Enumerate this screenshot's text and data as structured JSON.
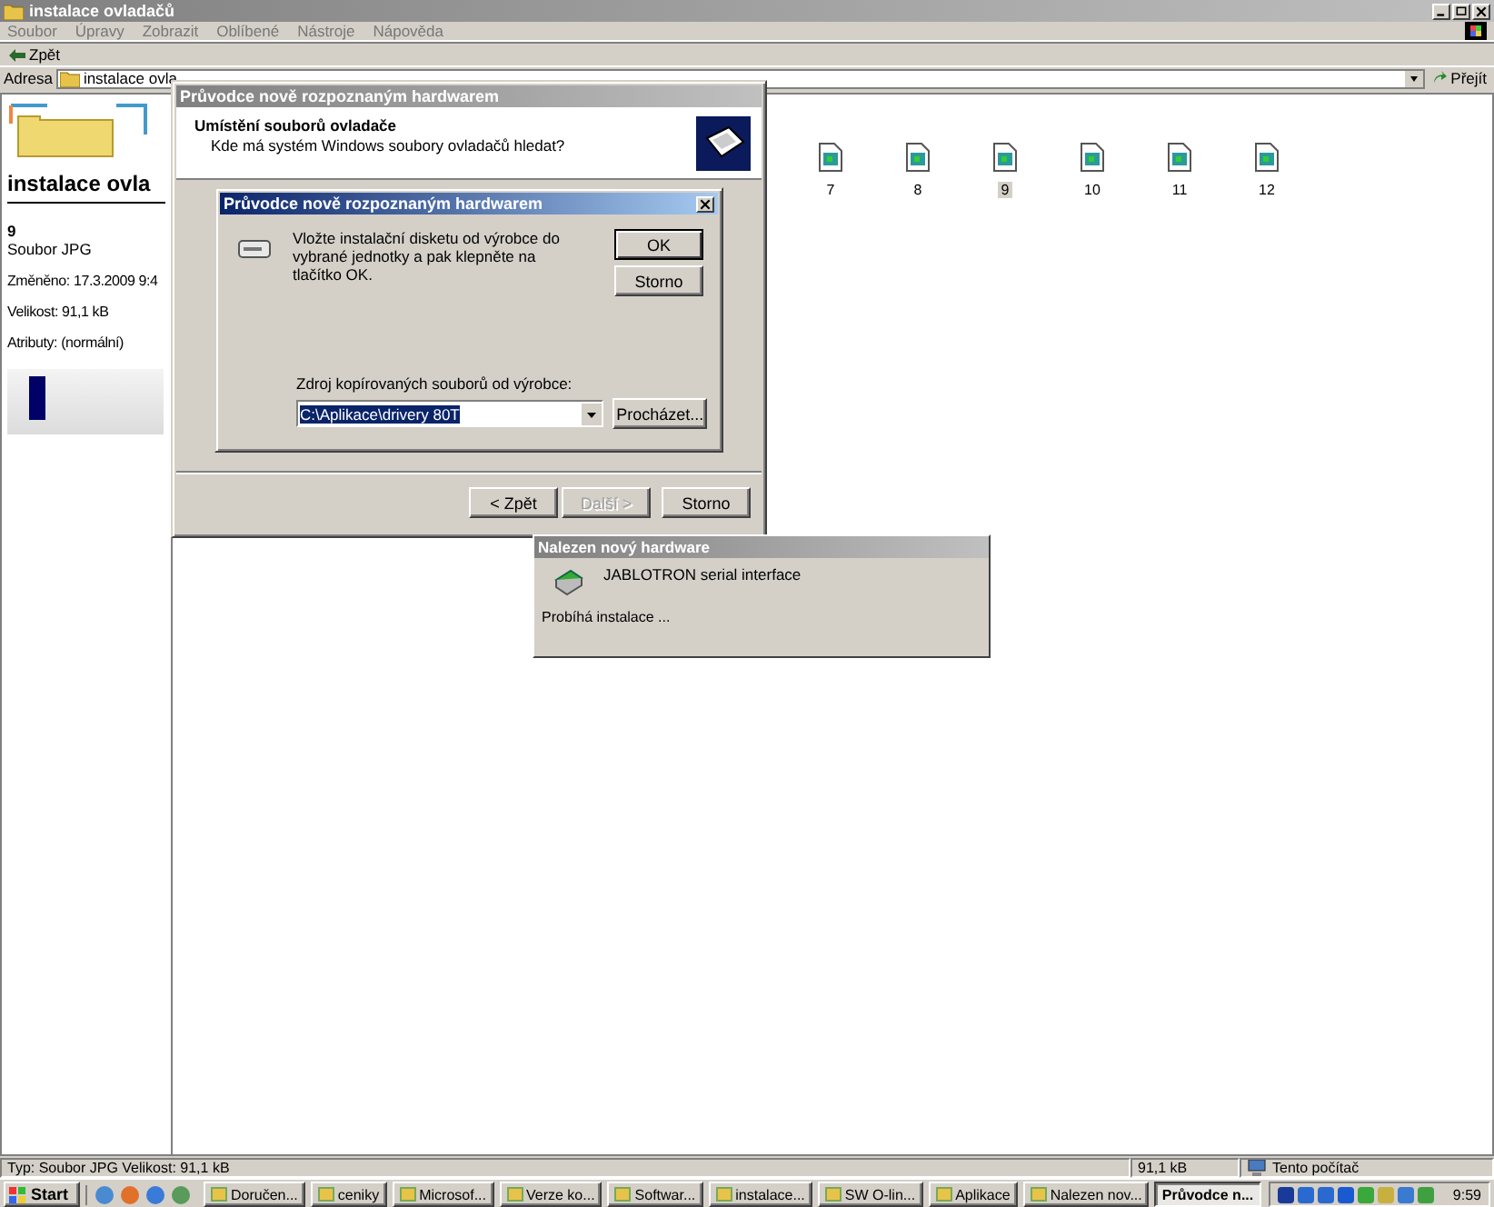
{
  "explorer": {
    "title": "instalace ovladačů",
    "menu": [
      "Soubor",
      "Úpravy",
      "Zobrazit",
      "Oblíbené",
      "Nástroje",
      "Nápověda"
    ],
    "toolbar": {
      "back": "Zpět"
    },
    "address": {
      "label": "Adresa",
      "value": "instalace ovla",
      "go": "Přejít"
    },
    "panel": {
      "heading": "instalace ovla",
      "name": "9",
      "type": "Soubor JPG",
      "details": [
        "Změněno: 17.3.2009 9:4",
        "Velikost: 91,1 kB",
        "Atributy: (normální)"
      ]
    },
    "files": [
      {
        "name": "7",
        "selected": false
      },
      {
        "name": "8",
        "selected": false
      },
      {
        "name": "9",
        "selected": true
      },
      {
        "name": "10",
        "selected": false
      },
      {
        "name": "11",
        "selected": false
      },
      {
        "name": "12",
        "selected": false
      }
    ],
    "status_bar": [
      "Typ: Soubor JPG Velikost: 91,1 kB",
      "91,1 kB",
      "Tento počítač"
    ]
  },
  "wizard": {
    "title": "Průvodce nově rozpoznaným hardwarem",
    "heading": "Umístění souborů ovladače",
    "subheading": "Kde má systém Windows soubory ovladačů hledat?",
    "buttons": [
      {
        "label": "< Zpět",
        "disabled": false
      },
      {
        "label": "Další >",
        "disabled": true
      },
      {
        "label": "Storno",
        "disabled": false
      }
    ]
  },
  "disk_dialog": {
    "title": "Průvodce nově rozpoznaným hardwarem",
    "message": "Vložte instalační disketu od výrobce do vybrané jednotky a pak klepněte na tlačítko OK.",
    "buttons": [
      "OK",
      "Storno"
    ],
    "source": {
      "label": "Zdroj kopírovaných souborů od výrobce:",
      "value": "C:\\Aplikace\\drivery 80T",
      "browse": "Procházet..."
    }
  },
  "notification": {
    "title": "Nalezen nový hardware",
    "device": "JABLOTRON serial interface",
    "status": "Probíhá instalace ..."
  },
  "taskbar": {
    "start": "Start",
    "tasks": [
      {
        "label": "Doručen...",
        "selected": false
      },
      {
        "label": "ceniky",
        "selected": false
      },
      {
        "label": "Microsof...",
        "selected": false
      },
      {
        "label": "Verze ko...",
        "selected": false
      },
      {
        "label": "Softwar...",
        "selected": false
      },
      {
        "label": "instalace...",
        "selected": false
      },
      {
        "label": "SW O-lin...",
        "selected": false
      },
      {
        "label": "Aplikace",
        "selected": false
      },
      {
        "label": "Nalezen nov...",
        "selected": false
      },
      {
        "label": "Průvodce n...",
        "selected": true
      }
    ],
    "clock": "9:59"
  }
}
